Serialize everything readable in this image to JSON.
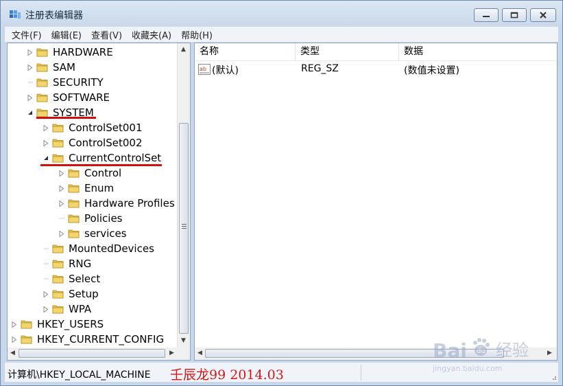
{
  "window": {
    "title": "注册表编辑器"
  },
  "menu": [
    "文件(F)",
    "编辑(E)",
    "查看(V)",
    "收藏夹(A)",
    "帮助(H)"
  ],
  "tree": [
    {
      "label": "HARDWARE",
      "level": 1,
      "expander": "collapsed"
    },
    {
      "label": "SAM",
      "level": 1,
      "expander": "collapsed"
    },
    {
      "label": "SECURITY",
      "level": 1,
      "expander": "none"
    },
    {
      "label": "SOFTWARE",
      "level": 1,
      "expander": "collapsed"
    },
    {
      "label": "SYSTEM",
      "level": 1,
      "expander": "expanded"
    },
    {
      "label": "ControlSet001",
      "level": 2,
      "expander": "collapsed"
    },
    {
      "label": "ControlSet002",
      "level": 2,
      "expander": "collapsed"
    },
    {
      "label": "CurrentControlSet",
      "level": 2,
      "expander": "expanded"
    },
    {
      "label": "Control",
      "level": 3,
      "expander": "collapsed"
    },
    {
      "label": "Enum",
      "level": 3,
      "expander": "collapsed"
    },
    {
      "label": "Hardware Profiles",
      "level": 3,
      "expander": "collapsed"
    },
    {
      "label": "Policies",
      "level": 3,
      "expander": "none"
    },
    {
      "label": "services",
      "level": 3,
      "expander": "collapsed"
    },
    {
      "label": "MountedDevices",
      "level": 2,
      "expander": "none"
    },
    {
      "label": "RNG",
      "level": 2,
      "expander": "none"
    },
    {
      "label": "Select",
      "level": 2,
      "expander": "none"
    },
    {
      "label": "Setup",
      "level": 2,
      "expander": "collapsed"
    },
    {
      "label": "WPA",
      "level": 2,
      "expander": "collapsed"
    },
    {
      "label": "HKEY_USERS",
      "level": 0,
      "expander": "collapsed"
    },
    {
      "label": "HKEY_CURRENT_CONFIG",
      "level": 0,
      "expander": "collapsed"
    }
  ],
  "list": {
    "columns": [
      "名称",
      "类型",
      "数据"
    ],
    "rows": [
      {
        "name": "(默认)",
        "type": "REG_SZ",
        "data": "(数值未设置)",
        "icon": "string-value-icon"
      }
    ]
  },
  "status": {
    "path": "计算机\\HKEY_LOCAL_MACHINE",
    "annotation": "壬辰龙99 2014.03"
  },
  "watermark": {
    "brand": "Bai",
    "brand2": "du",
    "cn": "经验",
    "url": "jingyan.baidu.com"
  },
  "colors": {
    "underline": "#d01010",
    "annotation": "#d01818",
    "folder": "#e8c14a"
  }
}
